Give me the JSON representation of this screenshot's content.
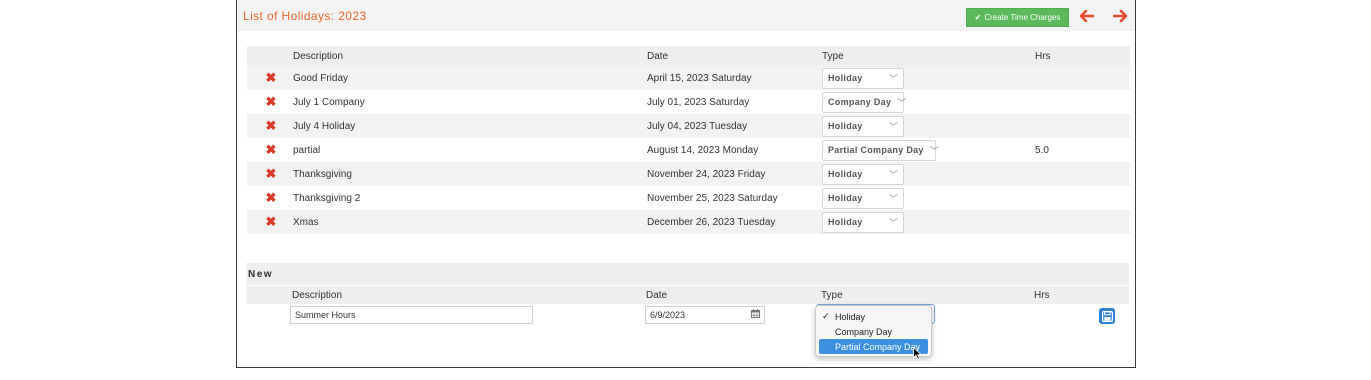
{
  "header": {
    "title": "List of Holidays: 2023",
    "create_label": "Create Time Charges",
    "prev_arrow": "🡐",
    "next_arrow": "🡒"
  },
  "columns": {
    "description": "Description",
    "date": "Date",
    "type": "Type",
    "hrs": "Hrs"
  },
  "holidays": [
    {
      "description": "Good Friday",
      "date": "April 15, 2023 Saturday",
      "type": "Holiday",
      "hrs": ""
    },
    {
      "description": "July 1 Company",
      "date": "July 01, 2023 Saturday",
      "type": "Company Day",
      "hrs": ""
    },
    {
      "description": "July 4 Holiday",
      "date": "July 04, 2023 Tuesday",
      "type": "Holiday",
      "hrs": ""
    },
    {
      "description": "partial",
      "date": "August 14, 2023 Monday",
      "type": "Partial Company Day",
      "hrs": "5.0"
    },
    {
      "description": "Thanksgiving",
      "date": "November 24, 2023 Friday",
      "type": "Holiday",
      "hrs": ""
    },
    {
      "description": "Thanksgiving 2",
      "date": "November 25, 2023 Saturday",
      "type": "Holiday",
      "hrs": ""
    },
    {
      "description": "Xmas",
      "date": "December 26, 2023 Tuesday",
      "type": "Holiday",
      "hrs": ""
    }
  ],
  "new_section": {
    "label": "New",
    "description_value": "Summer Hours",
    "date_value": "6/9/2023",
    "type_options": [
      "Holiday",
      "Company Day",
      "Partial Company Day"
    ],
    "checked_option": "Holiday",
    "highlighted_option": "Partial Company Day"
  },
  "icons": {
    "delete": "delete-icon",
    "calendar": "calendar-icon",
    "save": "save-icon",
    "check": "check-icon",
    "chevron": "chevron-down-icon"
  },
  "colors": {
    "title": "#e8672a",
    "create_button": "#5cb85c",
    "arrows": "#e8492a",
    "delete": "#d63c2a",
    "highlight": "#3d8fe0"
  }
}
